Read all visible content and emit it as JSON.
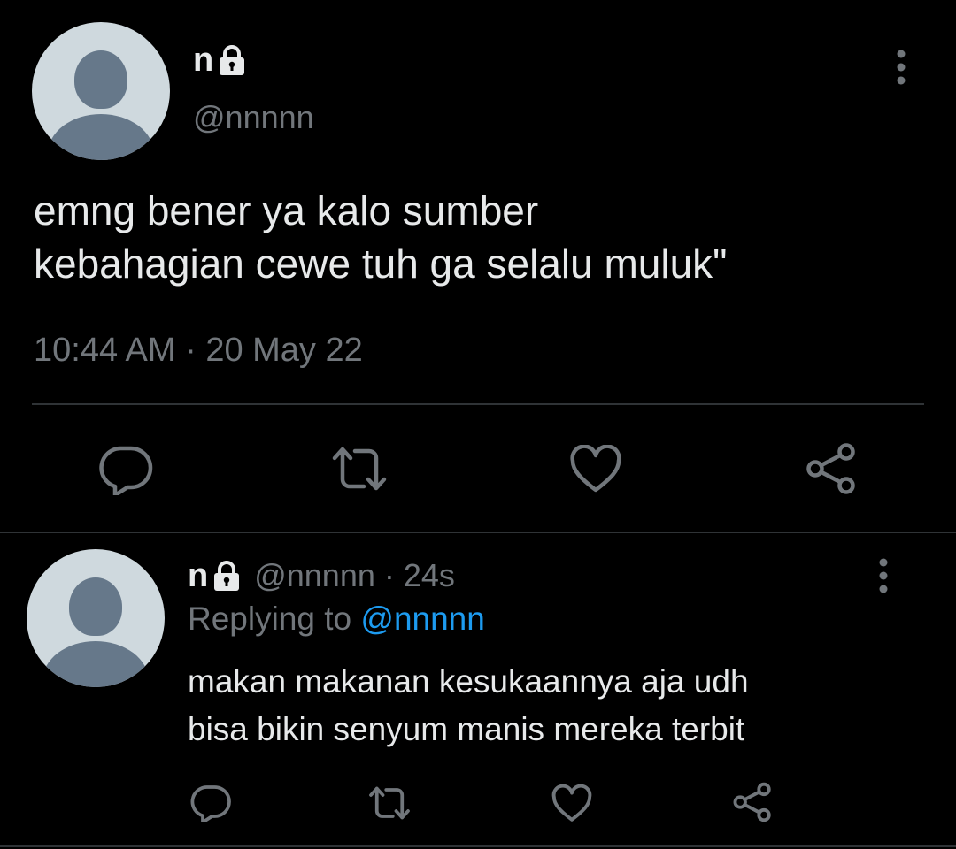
{
  "main_tweet": {
    "display_name": "n",
    "handle": "@nnnnn",
    "text_lines": [
      "emng bener ya kalo sumber",
      "kebahagian cewe tuh ga selalu muluk\""
    ],
    "timestamp": "10:44 AM · 20 May 22",
    "icons": {
      "lock": "lock-icon",
      "more": "more-vertical-icon",
      "actions": [
        "reply-icon",
        "retweet-icon",
        "like-icon",
        "share-icon"
      ]
    }
  },
  "reply": {
    "display_name": "n",
    "handle": "@nnnnn",
    "separator": "·",
    "age": "24s",
    "replying_prefix": "Replying to",
    "replying_to": "@nnnnn",
    "text_lines": [
      "makan makanan kesukaannya aja udh",
      "bisa bikin senyum manis mereka terbit"
    ]
  },
  "colors": {
    "background": "#000000",
    "text_primary": "#e7e9ea",
    "text_secondary": "#71767b",
    "link": "#1d9bf0",
    "divider": "#2f3336",
    "avatar_bg": "#cfd9de",
    "avatar_fg": "#66788a"
  }
}
